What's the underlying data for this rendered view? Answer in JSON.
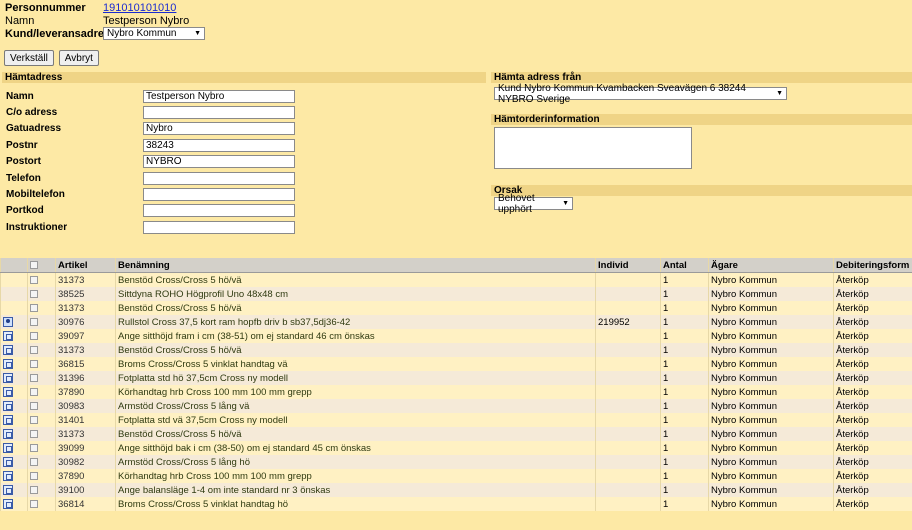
{
  "header": {
    "personnummer_label": "Personnummer",
    "personnummer_value": "191010101010",
    "namn_label": "Namn",
    "namn_value": "Testperson Nybro",
    "kund_label": "Kund/leveransadress",
    "kund_value": "Nybro Kommun"
  },
  "buttons": {
    "verkstall": "Verkställ",
    "avbryt": "Avbryt"
  },
  "hamtadress": {
    "title": "Hämtadress",
    "fields": [
      {
        "label": "Namn",
        "value": "Testperson Nybro"
      },
      {
        "label": "C/o adress",
        "value": ""
      },
      {
        "label": "Gatuadress",
        "value": "Nybro"
      },
      {
        "label": "Postnr",
        "value": "38243"
      },
      {
        "label": "Postort",
        "value": "NYBRO"
      },
      {
        "label": "Telefon",
        "value": ""
      },
      {
        "label": "Mobiltelefon",
        "value": ""
      },
      {
        "label": "Portkod",
        "value": ""
      },
      {
        "label": "Instruktioner",
        "value": ""
      }
    ]
  },
  "hamta_fran": {
    "title": "Hämta adress från",
    "value": "Kund Nybro Kommun Kvambacken Sveavägen 6 38244 NYBRO Sverige"
  },
  "hamtorder": {
    "title": "Hämtorderinformation",
    "value": ""
  },
  "orsak": {
    "title": "Orsak",
    "value": "Behovet upphört"
  },
  "table": {
    "columns": [
      "Artikel",
      "Benämning",
      "Individ",
      "Antal",
      "Ägare",
      "Debiteringsform"
    ],
    "rows": [
      {
        "icon": "",
        "artikel": "31373",
        "benamning": "Benstöd Cross/Cross 5 hö/vä",
        "individ": "",
        "antal": "1",
        "agare": "Nybro Kommun",
        "debitering": "Återköp"
      },
      {
        "icon": "",
        "artikel": "38525",
        "benamning": "Sittdyna ROHO Högprofil Uno 48x48 cm",
        "individ": "",
        "antal": "1",
        "agare": "Nybro Kommun",
        "debitering": "Återköp"
      },
      {
        "icon": "",
        "artikel": "31373",
        "benamning": "Benstöd Cross/Cross 5 hö/vä",
        "individ": "",
        "antal": "1",
        "agare": "Nybro Kommun",
        "debitering": "Återköp"
      },
      {
        "icon": "person",
        "artikel": "30976",
        "benamning": "Rullstol Cross 37,5 kort ram hopfb driv b sb37,5dj36-42",
        "individ": "219952",
        "antal": "1",
        "agare": "Nybro Kommun",
        "debitering": "Återköp"
      },
      {
        "icon": "tree",
        "artikel": "39097",
        "benamning": "Ange sitthöjd fram i cm (38-51) om ej standard 46 cm önskas",
        "individ": "",
        "antal": "1",
        "agare": "Nybro Kommun",
        "debitering": "Återköp"
      },
      {
        "icon": "tree",
        "artikel": "31373",
        "benamning": "Benstöd Cross/Cross 5 hö/vä",
        "individ": "",
        "antal": "1",
        "agare": "Nybro Kommun",
        "debitering": "Återköp"
      },
      {
        "icon": "tree",
        "artikel": "36815",
        "benamning": "Broms Cross/Cross 5 vinklat handtag vä",
        "individ": "",
        "antal": "1",
        "agare": "Nybro Kommun",
        "debitering": "Återköp"
      },
      {
        "icon": "tree",
        "artikel": "31396",
        "benamning": "Fotplatta std hö 37,5cm Cross ny modell",
        "individ": "",
        "antal": "1",
        "agare": "Nybro Kommun",
        "debitering": "Återköp"
      },
      {
        "icon": "tree",
        "artikel": "37890",
        "benamning": "Körhandtag hrb Cross 100 mm 100 mm grepp",
        "individ": "",
        "antal": "1",
        "agare": "Nybro Kommun",
        "debitering": "Återköp"
      },
      {
        "icon": "tree",
        "artikel": "30983",
        "benamning": "Armstöd Cross/Cross 5 lång vä",
        "individ": "",
        "antal": "1",
        "agare": "Nybro Kommun",
        "debitering": "Återköp"
      },
      {
        "icon": "tree",
        "artikel": "31401",
        "benamning": "Fotplatta std vä 37,5cm Cross ny modell",
        "individ": "",
        "antal": "1",
        "agare": "Nybro Kommun",
        "debitering": "Återköp"
      },
      {
        "icon": "tree",
        "artikel": "31373",
        "benamning": "Benstöd Cross/Cross 5 hö/vä",
        "individ": "",
        "antal": "1",
        "agare": "Nybro Kommun",
        "debitering": "Återköp"
      },
      {
        "icon": "tree",
        "artikel": "39099",
        "benamning": "Ange sitthöjd bak i cm (38-50) om ej standard 45 cm önskas",
        "individ": "",
        "antal": "1",
        "agare": "Nybro Kommun",
        "debitering": "Återköp"
      },
      {
        "icon": "tree",
        "artikel": "30982",
        "benamning": "Armstöd Cross/Cross 5 lång hö",
        "individ": "",
        "antal": "1",
        "agare": "Nybro Kommun",
        "debitering": "Återköp"
      },
      {
        "icon": "tree",
        "artikel": "37890",
        "benamning": "Körhandtag hrb Cross 100 mm 100 mm grepp",
        "individ": "",
        "antal": "1",
        "agare": "Nybro Kommun",
        "debitering": "Återköp"
      },
      {
        "icon": "tree",
        "artikel": "39100",
        "benamning": "Ange balansläge 1-4 om inte standard nr 3 önskas",
        "individ": "",
        "antal": "1",
        "agare": "Nybro Kommun",
        "debitering": "Återköp"
      },
      {
        "icon": "tree",
        "artikel": "36814",
        "benamning": "Broms Cross/Cross 5 vinklat handtag hö",
        "individ": "",
        "antal": "1",
        "agare": "Nybro Kommun",
        "debitering": "Återköp"
      }
    ]
  }
}
